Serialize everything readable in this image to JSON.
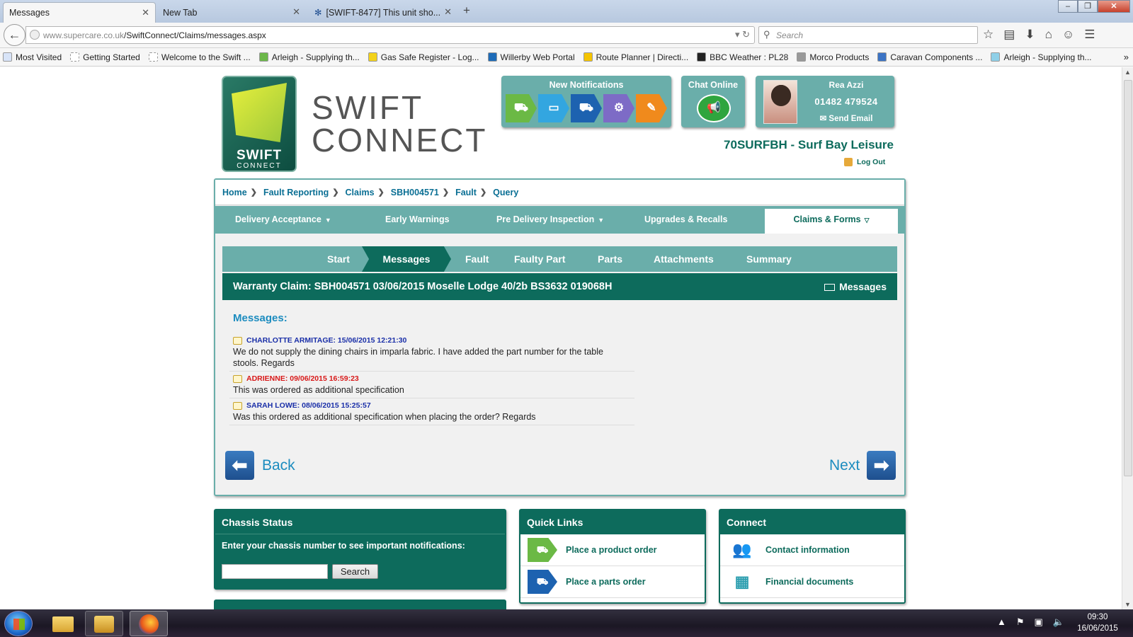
{
  "browser": {
    "tabs": [
      {
        "label": "Messages",
        "active": true
      },
      {
        "label": "New Tab",
        "active": false
      },
      {
        "label": "[SWIFT-8477] This unit sho...",
        "active": false
      }
    ],
    "url_domain": "www.supercare.co.uk",
    "url_path": "/SwiftConnect/Claims/messages.aspx",
    "search_placeholder": "Search",
    "bookmarks": [
      "Most Visited",
      "Getting Started",
      "Welcome to the Swift ...",
      "Arleigh - Supplying th...",
      "Gas Safe Register - Log...",
      "Willerby Web Portal",
      "Route Planner | Directi...",
      "BBC Weather : PL28",
      "Morco Products",
      "Caravan Components ...",
      "Arleigh - Supplying th..."
    ]
  },
  "header": {
    "logo_text": "SWIFT",
    "logo_sub": "CONNECT",
    "brand_line1": "SWIFT",
    "brand_line2": "CONNECT",
    "notifications_title": "New Notifications",
    "chat_title": "Chat Online",
    "user_name": "Rea Azzi",
    "user_phone": "01482 479524",
    "send_email": "Send Email",
    "dealer": "70SURFBH - Surf Bay Leisure",
    "logout": "Log Out"
  },
  "breadcrumb": [
    "Home",
    "Fault Reporting",
    "Claims",
    "SBH004571",
    "Fault",
    "Query"
  ],
  "main_nav": [
    {
      "label": "Delivery Acceptance",
      "dropdown": true
    },
    {
      "label": "Early Warnings",
      "dropdown": false
    },
    {
      "label": "Pre Delivery Inspection",
      "dropdown": true
    },
    {
      "label": "Upgrades & Recalls",
      "dropdown": false
    },
    {
      "label": "Claims & Forms",
      "dropdown": true,
      "active": true
    }
  ],
  "steps": [
    "Start",
    "Messages",
    "Fault",
    "Faulty Part",
    "Parts",
    "Attachments",
    "Summary"
  ],
  "active_step": "Messages",
  "claim": {
    "title": "Warranty Claim: SBH004571 03/06/2015 Moselle Lodge 40/2b BS3632 019068H",
    "messages_link": "Messages"
  },
  "messages_heading": "Messages:",
  "messages": [
    {
      "author": "CHARLOTTE ARMITAGE: 15/06/2015 12:21:30",
      "color": "#1a2fa8",
      "text": "We do not supply the dining chairs in imparla fabric. I have added the part number for the table stools. Regards"
    },
    {
      "author": "ADRIENNE: 09/06/2015 16:59:23",
      "color": "#d81818",
      "text": "This was ordered as additional specification"
    },
    {
      "author": "SARAH LOWE: 08/06/2015 15:25:57",
      "color": "#1a2fa8",
      "text": "Was this ordered as additional specification when placing the order? Regards"
    }
  ],
  "nav_buttons": {
    "back": "Back",
    "next": "Next"
  },
  "chassis": {
    "title": "Chassis Status",
    "label": "Enter your chassis number to see important notifications:",
    "button": "Search"
  },
  "quick_links": {
    "title": "Quick Links",
    "items": [
      "Place a product order",
      "Place a parts order"
    ]
  },
  "connect": {
    "title": "Connect",
    "items": [
      "Contact information",
      "Financial documents"
    ]
  },
  "taskbar": {
    "time": "09:30",
    "date": "16/06/2015"
  },
  "colors": {
    "teal": "#6aaeaa",
    "dark_teal": "#0d6b5c",
    "link_blue": "#1c8cbf"
  }
}
